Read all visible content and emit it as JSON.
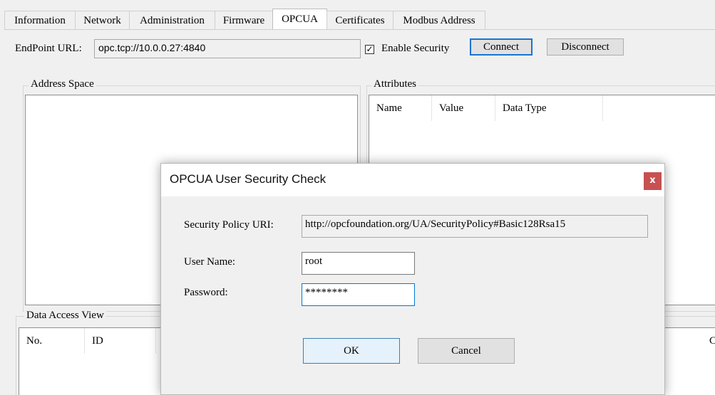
{
  "tabs": [
    "Information",
    "Network",
    "Administration",
    "Firmware",
    "OPCUA",
    "Certificates",
    "Modbus Address"
  ],
  "endpoint": {
    "label": "EndPoint URL:",
    "value": "opc.tcp://10.0.0.27:4840",
    "enable_security_label": "Enable Security",
    "enable_security_checked": true,
    "connect_label": "Connect",
    "disconnect_label": "Disconnect"
  },
  "address_space": {
    "title": "Address Space"
  },
  "attributes": {
    "title": "Attributes",
    "columns": [
      "Name",
      "Value",
      "Data Type"
    ]
  },
  "data_access": {
    "title": "Data Access View",
    "columns": [
      "No.",
      "ID"
    ],
    "partial_col_char": "C"
  },
  "dialog": {
    "title": "OPCUA User Security Check",
    "close_label": "x",
    "policy_label": "Security Policy URI:",
    "policy_value": "http://opcfoundation.org/UA/SecurityPolicy#Basic128Rsa15",
    "username_label": "User Name:",
    "username_value": "root",
    "password_label": "Password:",
    "password_value": "********",
    "ok_label": "OK",
    "cancel_label": "Cancel"
  }
}
